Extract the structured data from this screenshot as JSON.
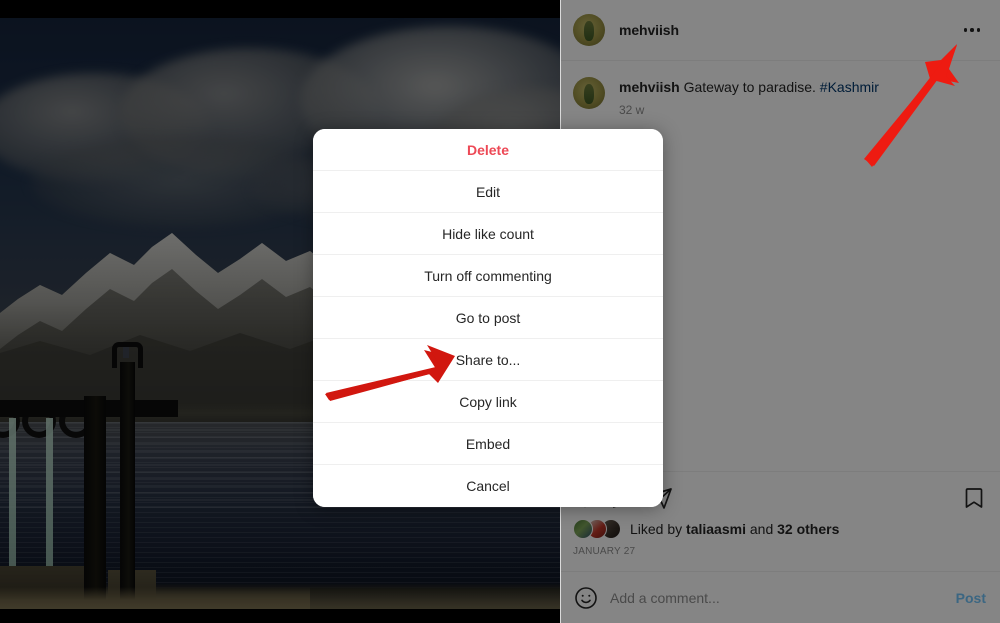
{
  "post": {
    "header": {
      "username": "mehviish",
      "avatar_icon": "user-avatar",
      "more_options_icon": "three-dots-icon"
    },
    "caption": {
      "username": "mehviish",
      "text": "Gateway to paradise.",
      "hashtag": "#Kashmir",
      "time_ago": "32 w"
    },
    "actions": {
      "like_icon": "heart-icon",
      "comment_icon": "comment-bubble-icon",
      "share_icon": "share-paper-plane-icon",
      "save_icon": "bookmark-icon"
    },
    "likes": {
      "prefix": "Liked by",
      "top_liker": "taliaasmi",
      "connector": "and",
      "others": "32 others"
    },
    "date": "JANUARY 27",
    "comment_box": {
      "emoji_icon": "smiley-face-icon",
      "placeholder": "Add a comment...",
      "value": "",
      "post_label": "Post"
    }
  },
  "modal": {
    "items": [
      {
        "label": "Delete",
        "style": "danger"
      },
      {
        "label": "Edit",
        "style": "normal"
      },
      {
        "label": "Hide like count",
        "style": "normal"
      },
      {
        "label": "Turn off commenting",
        "style": "normal"
      },
      {
        "label": "Go to post",
        "style": "normal"
      },
      {
        "label": "Share to...",
        "style": "normal"
      },
      {
        "label": "Copy link",
        "style": "normal"
      },
      {
        "label": "Embed",
        "style": "normal"
      },
      {
        "label": "Cancel",
        "style": "normal"
      }
    ]
  },
  "annotations": {
    "arrow_color": "#ee1b11",
    "arrows": [
      {
        "name": "arrow-to-more-options",
        "target": "three-dots-icon"
      },
      {
        "name": "arrow-to-share-to",
        "target": "Share to..."
      }
    ]
  },
  "colors": {
    "accent_blue": "#0095f6",
    "danger_red": "#ed4956",
    "link_blue": "#00376b",
    "text_primary": "#262626",
    "text_secondary": "#8e8e8e",
    "arrow_red": "#ee1b11"
  }
}
